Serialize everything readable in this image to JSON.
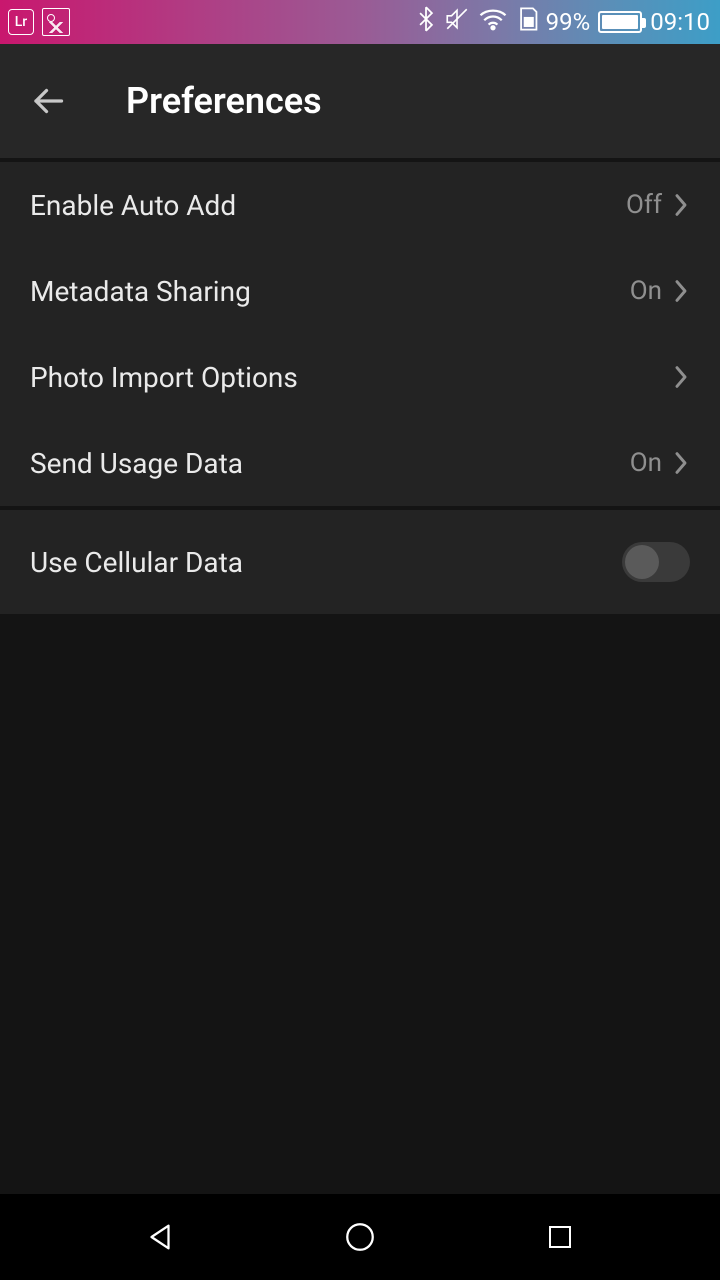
{
  "status_bar": {
    "lr_label": "Lr",
    "battery_percent": "99%",
    "time": "09:10"
  },
  "header": {
    "title": "Preferences"
  },
  "settings": {
    "group1": [
      {
        "label": "Enable Auto Add",
        "value": "Off"
      },
      {
        "label": "Metadata Sharing",
        "value": "On"
      },
      {
        "label": "Photo Import Options",
        "value": ""
      },
      {
        "label": "Send Usage Data",
        "value": "On"
      }
    ],
    "group2": [
      {
        "label": "Use Cellular Data",
        "toggle": false
      }
    ]
  }
}
